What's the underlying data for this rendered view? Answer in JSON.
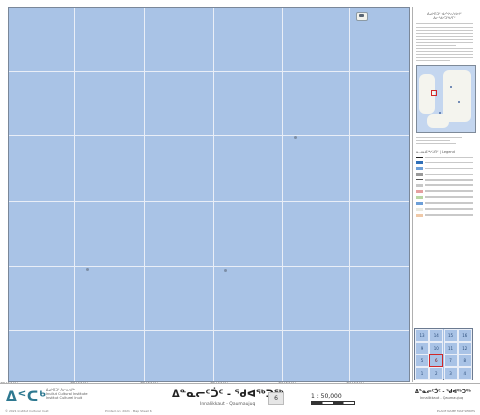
{
  "map": {
    "sea_color": "#a9c3e6",
    "grid_color": "#e9eef7",
    "top_ticks": [
      "",
      "",
      "",
      "",
      ""
    ],
    "bottom_ticks": [
      "72°30'W",
      "72°00'W",
      "71°30'W",
      "71°00'W",
      "70°30'W",
      "70°00'W"
    ],
    "right_ticks": [
      "",
      "",
      ""
    ]
  },
  "sidebar": {
    "title": "ᐃᓄᒃᑎᑐᑦ ᐊᓯᔾᔨᕆᔭᐅᔪᑦ ᐃᓕᖁᓯᑐᖃᕐᒥᑦ",
    "legend_title": "ᓇᓗᓇᐃᖅᓯᒍᑎᑦ | Legend",
    "index_cells": [
      {
        "label": "13",
        "current": false
      },
      {
        "label": "14",
        "current": false
      },
      {
        "label": "15",
        "current": false
      },
      {
        "label": "16",
        "current": false
      },
      {
        "label": "9",
        "current": false
      },
      {
        "label": "10",
        "current": false
      },
      {
        "label": "11",
        "current": false
      },
      {
        "label": "12",
        "current": false
      },
      {
        "label": "5",
        "current": false
      },
      {
        "label": "6",
        "current": true
      },
      {
        "label": "7",
        "current": false
      },
      {
        "label": "8",
        "current": false
      },
      {
        "label": "1",
        "current": false
      },
      {
        "label": "2",
        "current": false
      },
      {
        "label": "3",
        "current": false
      },
      {
        "label": "4",
        "current": false
      }
    ]
  },
  "footer": {
    "logo": "ᐃᑉᑕᒃ",
    "logo_lines": [
      "ᐃᓄᒃᑎᑐᑦ ᐱᓕᕆᐊᖅ",
      "Inullut Cultural Institute",
      "Institut Culturel Inuit"
    ],
    "meta_left": "© 2021 Institut Culturel Inuit",
    "meta_mid": "Printed on: 2021 · Map Sheet 6",
    "title": "ᐃᓐᓇᓕᑦᑑᑦ - ᖁᐊᖅᑐᖅ",
    "subtitle": "Innalikkaut - Qaumaujuq",
    "sheet_number": "6",
    "scale": "1 : 50,000",
    "right_title": "ᐃᓐᓇᓕᑦᑑᑦ - ᖁᐊᖅᑐᖅ",
    "right_sub": "Innalikkaut - Qaumaujuq",
    "meta_right": "PLACE NAME MAP SERIES"
  }
}
